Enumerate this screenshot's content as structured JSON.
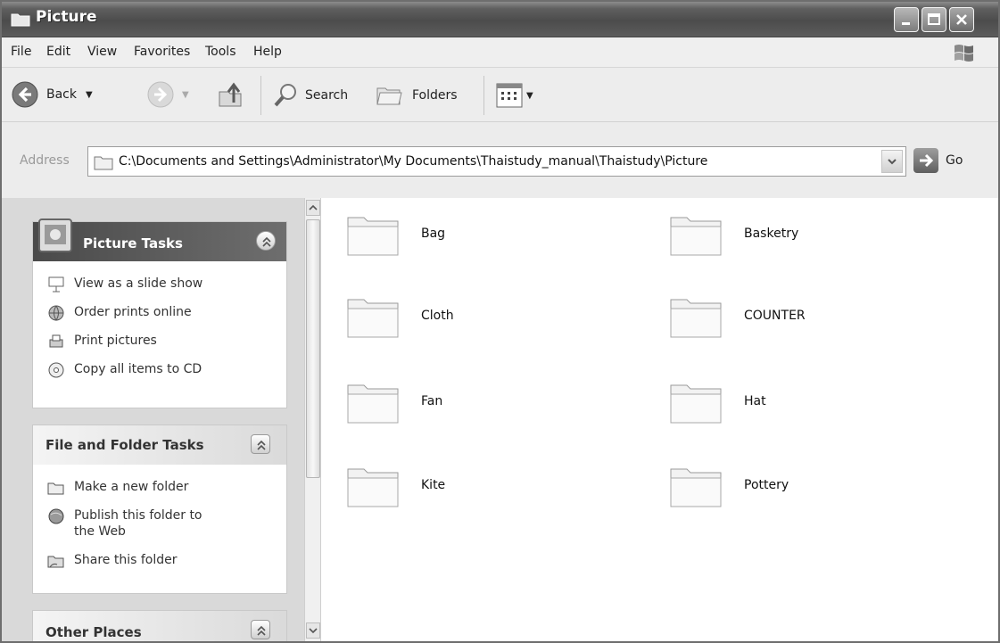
{
  "window": {
    "title": "Picture"
  },
  "menu": {
    "file": "File",
    "edit": "Edit",
    "view": "View",
    "favorites": "Favorites",
    "tools": "Tools",
    "help": "Help"
  },
  "toolbar": {
    "back": "Back",
    "search": "Search",
    "folders": "Folders"
  },
  "address": {
    "label": "Address",
    "path": "C:\\Documents and Settings\\Administrator\\My Documents\\Thaistudy_manual\\Thaistudy\\Picture",
    "go": "Go"
  },
  "sidebar": {
    "picture_tasks": {
      "title": "Picture Tasks",
      "items": [
        "View as a slide show",
        "Order prints online",
        "Print pictures",
        "Copy all items to CD"
      ]
    },
    "file_folder_tasks": {
      "title": "File and Folder Tasks",
      "items": [
        "Make a new folder",
        "Publish this folder to the Web",
        "Share this folder"
      ]
    },
    "other_places": {
      "title": "Other Places"
    }
  },
  "folders": [
    "Bag",
    "Basketry",
    "Cloth",
    "COUNTER",
    "Fan",
    "Hat",
    "Kite",
    "Pottery"
  ],
  "colors": {
    "titlebar": "#4c4c4c",
    "taskpane": "#d9d9d9",
    "content": "#ffffff"
  }
}
